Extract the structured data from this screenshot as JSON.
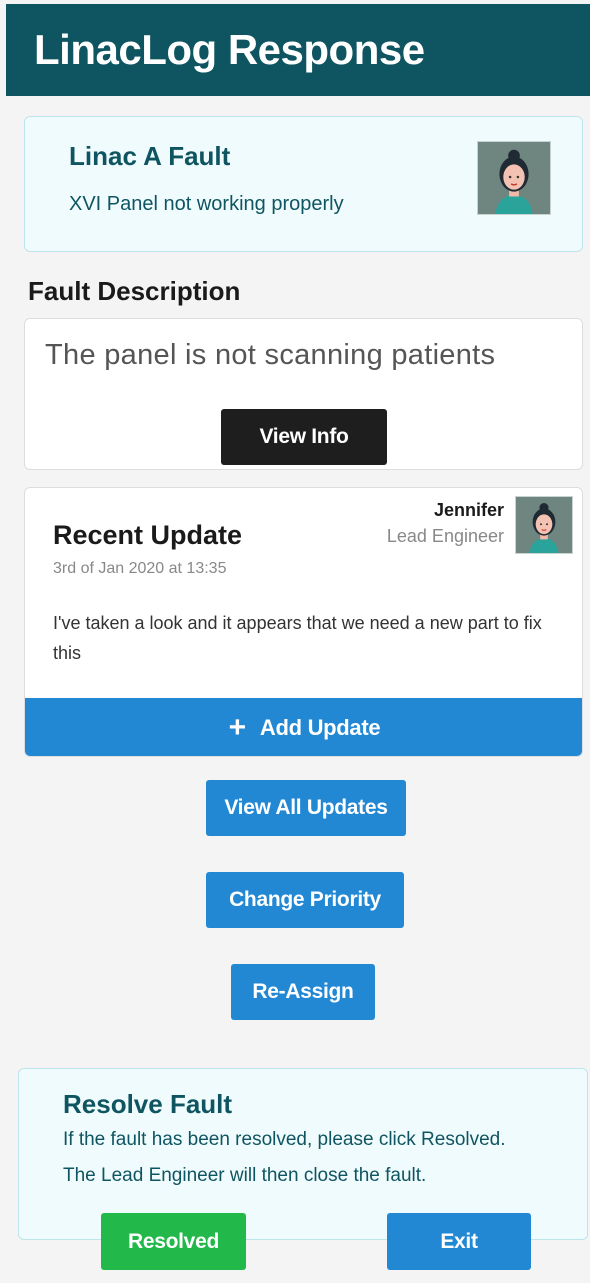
{
  "header": {
    "title": "LinacLog Response"
  },
  "fault": {
    "title": "Linac A Fault",
    "subtitle": "XVI Panel not working properly"
  },
  "description": {
    "heading": "Fault Description",
    "text": "The panel is not scanning patients",
    "view_info_label": "View Info"
  },
  "update": {
    "title": "Recent Update",
    "date": "3rd of Jan 2020 at 13:35",
    "engineer_name": "Jennifer",
    "engineer_role": "Lead Engineer",
    "body": "I've taken a look and it appears that we need a new part to fix this",
    "add_update_label": "Add Update"
  },
  "actions": {
    "view_all_label": "View All Updates",
    "change_priority_label": "Change Priority",
    "reassign_label": "Re-Assign"
  },
  "resolve": {
    "title": "Resolve Fault",
    "line1": "If the fault has been resolved, please click Resolved.",
    "line2": "The Lead Engineer will then close the fault.",
    "resolved_label": "Resolved",
    "exit_label": "Exit"
  },
  "colors": {
    "header_bg": "#0f5561",
    "accent_blue": "#2388d4",
    "success_green": "#22b84a",
    "dark_button": "#1e1e1e"
  },
  "icons": {
    "add": "plus-icon",
    "avatar": "avatar-female-icon"
  }
}
